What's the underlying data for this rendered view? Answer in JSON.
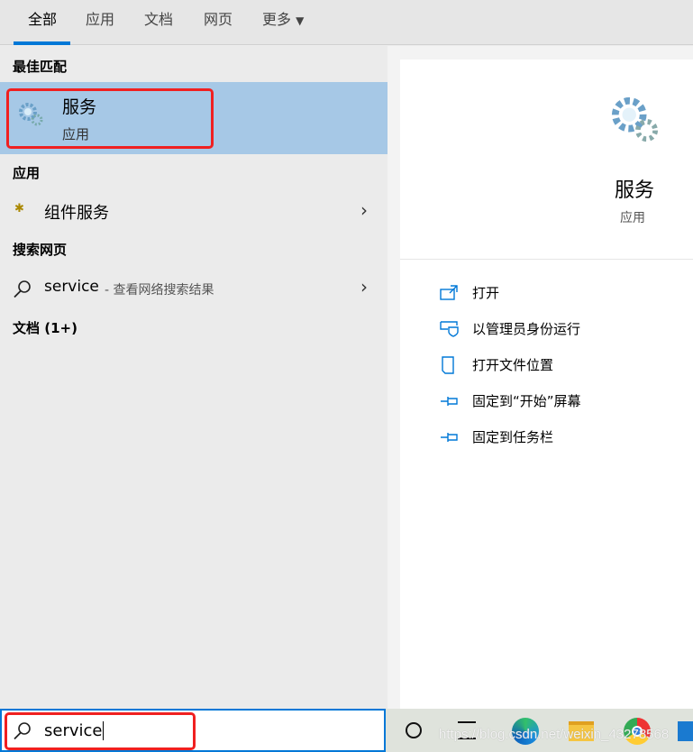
{
  "tabs": [
    {
      "label": "全部"
    },
    {
      "label": "应用"
    },
    {
      "label": "文档"
    },
    {
      "label": "网页"
    },
    {
      "label": "更多"
    }
  ],
  "sections": {
    "best": "最佳匹配",
    "apps": "应用",
    "web": "搜索网页",
    "docs": "文档 (1+)"
  },
  "best_match": {
    "title": "服务",
    "subtitle": "应用",
    "icon": "gears-icon"
  },
  "apps": [
    {
      "label": "组件服务",
      "icon": "component-services-icon"
    }
  ],
  "web": {
    "query": "service",
    "suffix": " - 查看网络搜索结果"
  },
  "detail": {
    "title": "服务",
    "subtitle": "应用",
    "actions": [
      {
        "label": "打开",
        "icon": "open-icon"
      },
      {
        "label": "以管理员身份运行",
        "icon": "shield-icon"
      },
      {
        "label": "打开文件位置",
        "icon": "folder-icon"
      },
      {
        "label": "固定到“开始”屏幕",
        "icon": "pin-icon"
      },
      {
        "label": "固定到任务栏",
        "icon": "pin-icon"
      }
    ]
  },
  "search": {
    "value": "service"
  },
  "watermark": "https://blog.csdn.net/weixin_43278568",
  "colors": {
    "accent": "#0078d7",
    "selection": "#a6c8e6",
    "highlight": "#f02020"
  }
}
